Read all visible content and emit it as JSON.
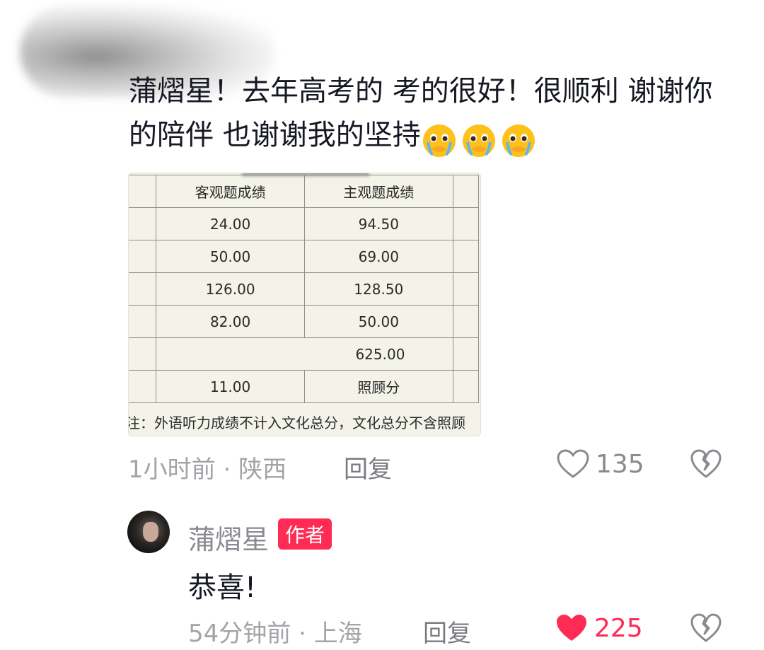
{
  "comment": {
    "text": "蒲熠星！去年高考的 考的很好！很顺利 谢谢你的陪伴 也谢谢我的坚持",
    "emojis": [
      "crying-emoji",
      "crying-emoji",
      "crying-emoji"
    ],
    "image": {
      "headers": [
        "客观题成绩",
        "主观题成绩"
      ],
      "rows": [
        [
          "24.00",
          "94.50"
        ],
        [
          "50.00",
          "69.00"
        ],
        [
          "126.00",
          "128.50"
        ],
        [
          "82.00",
          "50.00"
        ],
        [
          "",
          "625.00"
        ],
        [
          "11.00",
          "照顾分"
        ]
      ],
      "note": "注：外语听力成绩不计入文化总分，文化总分不含照顾"
    },
    "time": "1小时前",
    "separator": "·",
    "location": "陕西",
    "reply_label": "回复",
    "like_count": "135"
  },
  "reply": {
    "user_name": "蒲熠星",
    "badge": "作者",
    "text": "恭喜!",
    "time": "54分钟前",
    "separator": "·",
    "location": "上海",
    "reply_label": "回复",
    "like_count": "225",
    "liked": true
  },
  "colors": {
    "accent": "#fe2c55",
    "text": "#161823",
    "meta": "#a3a3a8"
  }
}
